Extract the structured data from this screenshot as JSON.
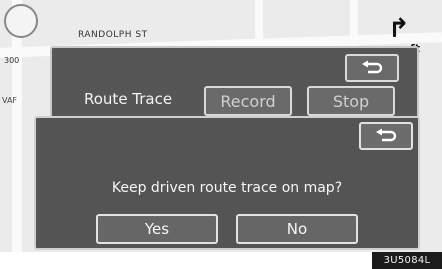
{
  "map": {
    "street_name": "RANDOLPH ST",
    "scale_label": "300",
    "side_label": "VAF",
    "distance_unit": "ft",
    "turn_icon": "turn-right-arrow-icon"
  },
  "route_trace_dialog": {
    "title": "Route Trace",
    "record_label": "Record",
    "stop_label": "Stop",
    "back_icon": "return-arrow-icon"
  },
  "confirm_dialog": {
    "message": "Keep driven route trace on map?",
    "yes_label": "Yes",
    "no_label": "No",
    "back_icon": "return-arrow-icon"
  },
  "figure_code": "3U5084L",
  "colors": {
    "dialog_bg": "#555555",
    "button_border": "#dadada",
    "text": "#f5f5f5",
    "map_bg": "#ebebeb"
  }
}
